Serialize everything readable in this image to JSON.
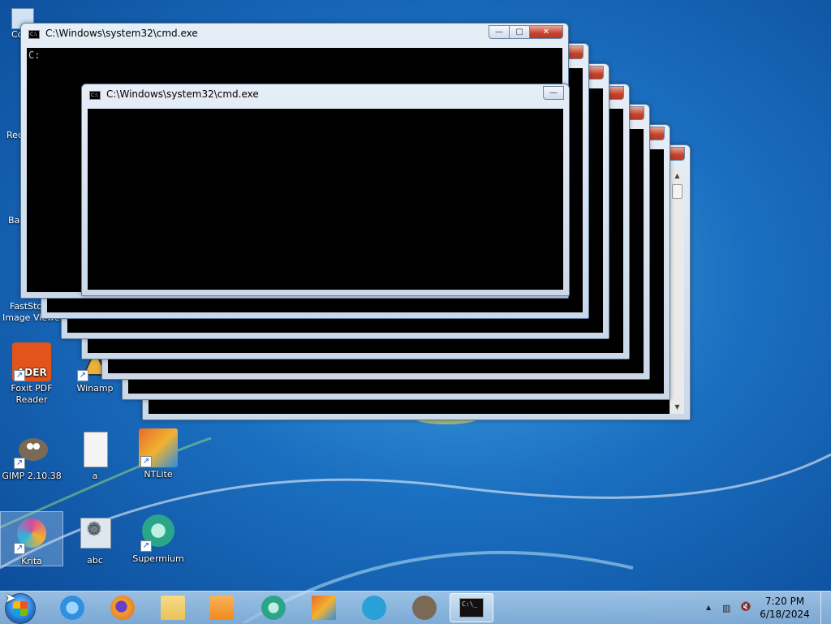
{
  "desktop": {
    "icons": [
      {
        "label": "Foxit PDF Reader",
        "icon": "foxit-icon",
        "color": "#e2541b"
      },
      {
        "label": "Winamp",
        "icon": "winamp-icon",
        "color": "#e9b23a"
      },
      {
        "label": "GIMP 2.10.38",
        "icon": "gimp-icon",
        "color": "#7a6a55"
      },
      {
        "label": "a",
        "icon": "text-file-icon",
        "color": "#f0f0f0"
      },
      {
        "label": "NTLite",
        "icon": "ntlite-icon",
        "color": "#e86a2a"
      },
      {
        "label": "Krita",
        "icon": "krita-icon",
        "color": "#d84a9c"
      },
      {
        "label": "abc",
        "icon": "settings-file-icon",
        "color": "#dfe6ee"
      },
      {
        "label": "Supermium",
        "icon": "supermium-icon",
        "color": "#2aa58a"
      }
    ],
    "partial_labels": {
      "co": "Co",
      "rec": "Rec",
      "ba": "Ba",
      "faststone": "FastSto",
      "image_viewer": "Image Viewer"
    }
  },
  "cmd_windows": {
    "title": "C:\\Windows\\system32\\cmd.exe",
    "prompt": "C:",
    "minimize_label": "—",
    "maximize_label": "▢",
    "close_label": "✕"
  },
  "taskbar": {
    "pinned": [
      {
        "name": "internet-explorer-icon",
        "color": "#2f8fe0"
      },
      {
        "name": "firefox-icon",
        "color": "#e8632a"
      },
      {
        "name": "file-explorer-icon",
        "color": "#e8c25a"
      },
      {
        "name": "media-player-icon",
        "color": "#f08a1c"
      },
      {
        "name": "supermium-icon",
        "color": "#2aa58a"
      },
      {
        "name": "ntlite-icon",
        "color": "#e86a2a"
      },
      {
        "name": "telegram-icon",
        "color": "#2aa0d8"
      },
      {
        "name": "gimp-icon",
        "color": "#7a6a55"
      },
      {
        "name": "cmd-icon",
        "color": "#111111"
      }
    ],
    "cmd_icon_text": "C:\\_",
    "clock_time": "7:20 PM",
    "clock_date": "6/18/2024",
    "tray_icons": [
      "show-hidden-icons-arrow",
      "network-icon",
      "volume-muted-icon"
    ],
    "tray_arrow": "▲",
    "network_glyph": "▥",
    "volume_glyph": "🔇"
  },
  "colors": {
    "close_red": "#c4422c",
    "console_black": "#000000",
    "window_frame": "#cad8e8"
  }
}
